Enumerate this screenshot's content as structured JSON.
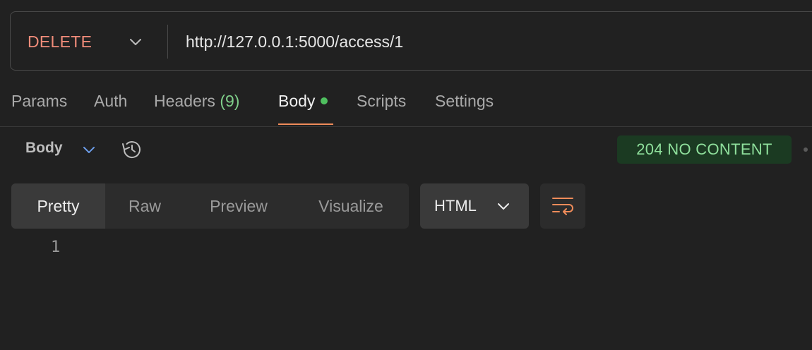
{
  "request": {
    "method": "DELETE",
    "url": "http://127.0.0.1:5000/access/1"
  },
  "tabs": [
    {
      "label": "Params"
    },
    {
      "label": "Auth"
    },
    {
      "label": "Headers",
      "count": "(9)"
    },
    {
      "label": "Body",
      "active": true,
      "indicator": "green-dot"
    },
    {
      "label": "Scripts"
    },
    {
      "label": "Settings"
    }
  ],
  "response": {
    "view_label": "Body",
    "status": "204 NO CONTENT",
    "formats": [
      "Pretty",
      "Raw",
      "Preview",
      "Visualize"
    ],
    "active_format": "Pretty",
    "language": "HTML",
    "line_numbers": [
      "1"
    ]
  },
  "colors": {
    "method": "#f08c7a",
    "accent": "#f08c5a",
    "status_bg": "#1b3a22",
    "status_text": "#8fe09c",
    "dot": "#4fbf5f"
  },
  "icons": {
    "method_dropdown": "chevron-down-icon",
    "view_dropdown": "chevron-down-icon",
    "history": "history-icon",
    "language_dropdown": "chevron-down-icon",
    "wrap": "wrap-lines-icon"
  }
}
